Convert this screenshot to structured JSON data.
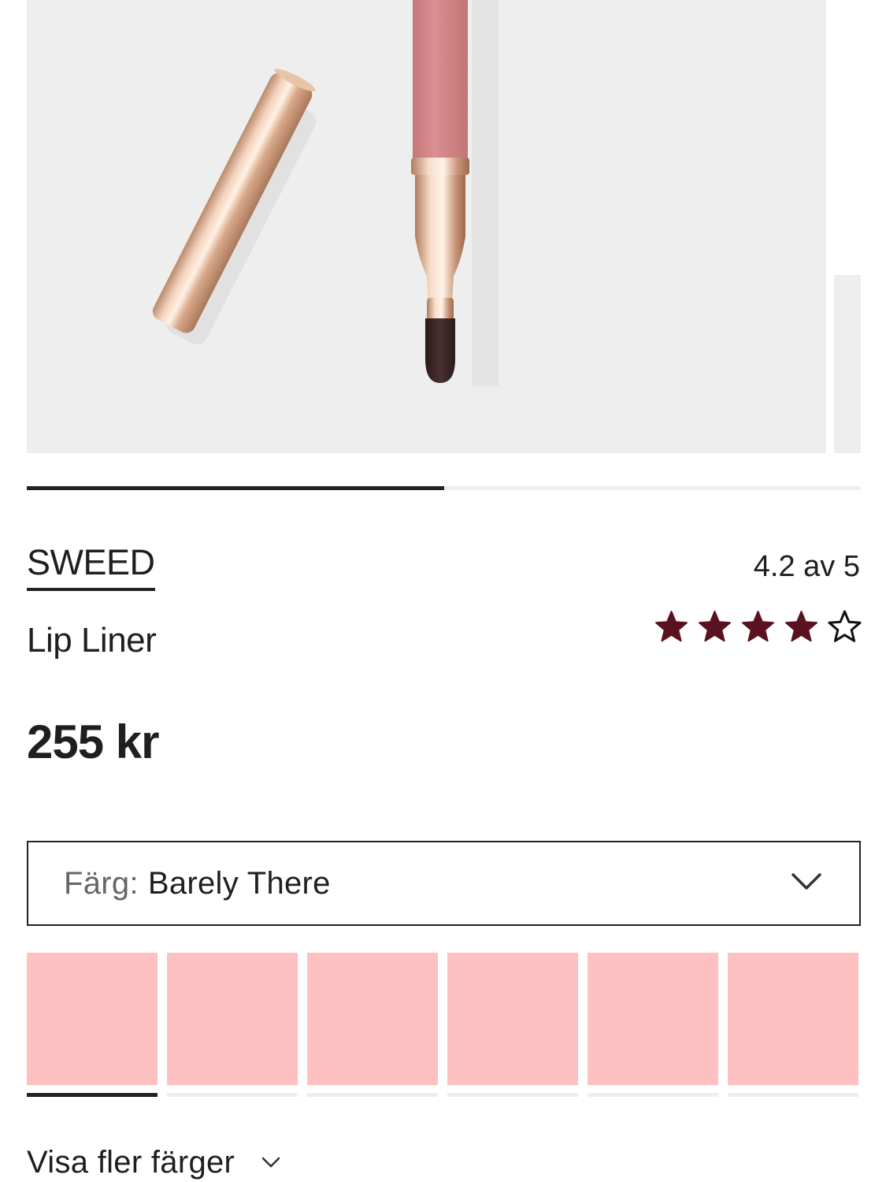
{
  "product": {
    "brand": "SWEED",
    "name": "Lip Liner",
    "price": "255 kr",
    "rating_text": "4.2 av 5",
    "rating_value": 4.2,
    "rating_max": 5,
    "filled_stars": 4
  },
  "gallery": {
    "progress_fraction": 0.5,
    "image": "lip-liner-pencil-with-cap"
  },
  "color_select": {
    "label": "Färg:",
    "value": "Barely There"
  },
  "swatches": [
    {
      "color": "#fec1c1",
      "selected": true
    },
    {
      "color": "#fec1c1",
      "selected": false
    },
    {
      "color": "#fec1c1",
      "selected": false
    },
    {
      "color": "#fec1c1",
      "selected": false
    },
    {
      "color": "#fec1c1",
      "selected": false
    },
    {
      "color": "#fec1c1",
      "selected": false
    }
  ],
  "more_colors_label": "Visa fler färger",
  "colors": {
    "star": "#5a1220",
    "text": "#1f1f1f",
    "muted": "#666666",
    "gallery_bg": "#eeeeee"
  }
}
